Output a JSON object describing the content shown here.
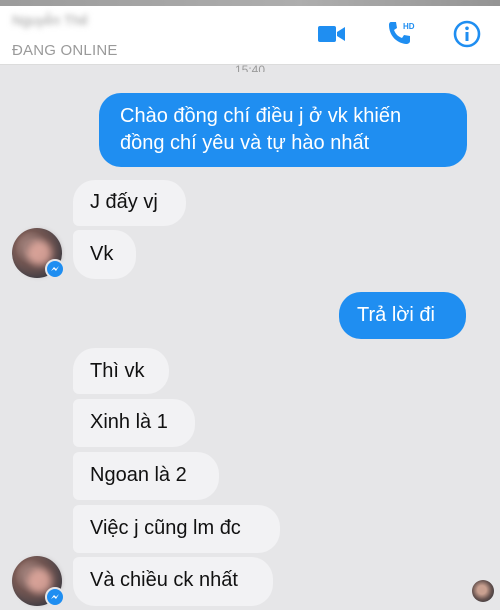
{
  "header": {
    "contact_name": "Nguyễn Thế",
    "status": "ĐANG ONLINE",
    "accent_color": "#1f8ef1",
    "actions": {
      "video_icon": "video-call-icon",
      "call_icon": "hd-phone-icon",
      "call_badge": "HD",
      "info_icon": "info-icon"
    }
  },
  "thread": {
    "timestamp": "15:40",
    "messages": [
      {
        "from": "me",
        "lines": [
          "Chào đồng chí điều j ở vk khiến",
          "đồng chí yêu và tự hào nhất"
        ]
      },
      {
        "from": "them",
        "text": "J đấy vj"
      },
      {
        "from": "them",
        "text": "Vk"
      },
      {
        "from": "me",
        "text": "Trả lời đi"
      },
      {
        "from": "them",
        "text": "Thì vk"
      },
      {
        "from": "them",
        "text": "Xinh là 1"
      },
      {
        "from": "them",
        "text": "Ngoan là 2"
      },
      {
        "from": "them",
        "text": "Việc j cũng lm đc"
      },
      {
        "from": "them",
        "text": "Và chiều ck nhất"
      }
    ]
  }
}
